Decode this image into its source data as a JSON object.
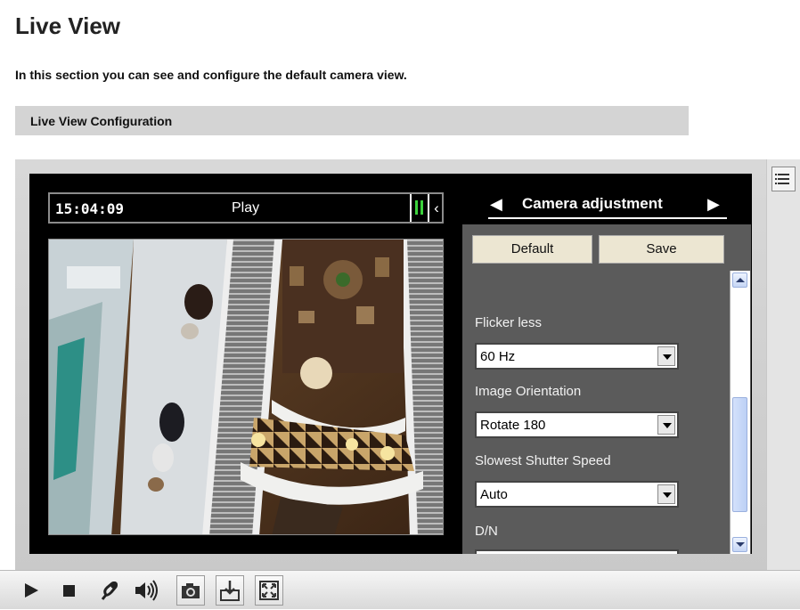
{
  "page": {
    "title": "Live View",
    "description": "In this section you can see and configure the default camera view.",
    "section_title": "Live View Configuration"
  },
  "player": {
    "time": "15:04:09",
    "status": "Play",
    "icons": {
      "pause_indicator": "pause-indicator-icon",
      "collapse": "chevron-left-icon"
    }
  },
  "camera_panel": {
    "title": "Camera adjustment",
    "default_label": "Default",
    "save_label": "Save",
    "fields": [
      {
        "label": "Flicker less",
        "value": "60 Hz"
      },
      {
        "label": "Image Orientation",
        "value": "Rotate 180"
      },
      {
        "label": "Slowest Shutter Speed",
        "value": "Auto"
      },
      {
        "label": "D/N",
        "value": ""
      }
    ]
  },
  "toolbar": {
    "buttons": [
      "play-icon",
      "stop-icon",
      "microphone-icon",
      "speaker-icon",
      "snapshot-icon",
      "record-icon",
      "fullscreen-icon"
    ]
  },
  "colors": {
    "section_bar": "#d4d4d4",
    "player_bg": "#000000",
    "panel_bg": "#5b5b5b",
    "button_bg": "#ece6d2",
    "pause_green": "#3cd23c"
  }
}
